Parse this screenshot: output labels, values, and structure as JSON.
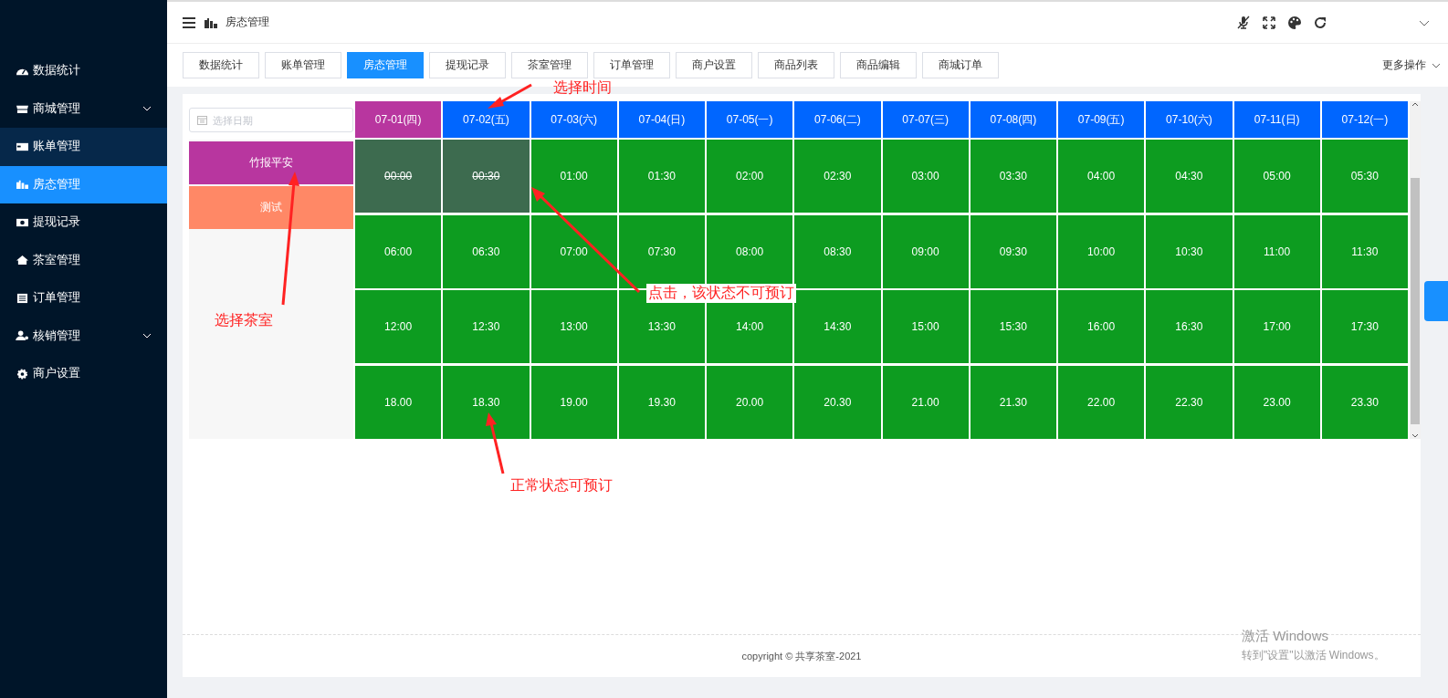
{
  "sidebar": {
    "items": [
      {
        "label": "数据统计",
        "expandable": false,
        "selected": false,
        "hovered": false
      },
      {
        "label": "商城管理",
        "expandable": true,
        "selected": false,
        "hovered": false
      },
      {
        "label": "账单管理",
        "expandable": false,
        "selected": false,
        "hovered": true
      },
      {
        "label": "房态管理",
        "expandable": false,
        "selected": true,
        "hovered": false
      },
      {
        "label": "提现记录",
        "expandable": false,
        "selected": false,
        "hovered": false
      },
      {
        "label": "茶室管理",
        "expandable": false,
        "selected": false,
        "hovered": false
      },
      {
        "label": "订单管理",
        "expandable": false,
        "selected": false,
        "hovered": false
      },
      {
        "label": "核销管理",
        "expandable": true,
        "selected": false,
        "hovered": false
      },
      {
        "label": "商户设置",
        "expandable": false,
        "selected": false,
        "hovered": false
      }
    ]
  },
  "header": {
    "breadcrumb": "房态管理"
  },
  "tabs": [
    {
      "label": "数据统计",
      "selected": false
    },
    {
      "label": "账单管理",
      "selected": false
    },
    {
      "label": "房态管理",
      "selected": true
    },
    {
      "label": "提现记录",
      "selected": false
    },
    {
      "label": "茶室管理",
      "selected": false
    },
    {
      "label": "订单管理",
      "selected": false
    },
    {
      "label": "商户设置",
      "selected": false
    },
    {
      "label": "商品列表",
      "selected": false
    },
    {
      "label": "商品编辑",
      "selected": false
    },
    {
      "label": "商城订单",
      "selected": false
    }
  ],
  "more_actions": "更多操作",
  "date_picker": {
    "placeholder": "选择日期"
  },
  "rooms": [
    {
      "name": "竹报平安",
      "selected": true
    },
    {
      "name": "测试",
      "selected": false
    }
  ],
  "dates": [
    {
      "label": "07-01(四)",
      "selected": true
    },
    {
      "label": "07-02(五)",
      "selected": false
    },
    {
      "label": "07-03(六)",
      "selected": false
    },
    {
      "label": "07-04(日)",
      "selected": false
    },
    {
      "label": "07-05(一)",
      "selected": false
    },
    {
      "label": "07-06(二)",
      "selected": false
    },
    {
      "label": "07-07(三)",
      "selected": false
    },
    {
      "label": "07-08(四)",
      "selected": false
    },
    {
      "label": "07-09(五)",
      "selected": false
    },
    {
      "label": "07-10(六)",
      "selected": false
    },
    {
      "label": "07-11(日)",
      "selected": false
    },
    {
      "label": "07-12(一)",
      "selected": false
    }
  ],
  "slots": [
    {
      "time": "00:00",
      "booked": true
    },
    {
      "time": "00:30",
      "booked": true
    },
    {
      "time": "01:00",
      "booked": false
    },
    {
      "time": "01:30",
      "booked": false
    },
    {
      "time": "02:00",
      "booked": false
    },
    {
      "time": "02:30",
      "booked": false
    },
    {
      "time": "03:00",
      "booked": false
    },
    {
      "time": "03:30",
      "booked": false
    },
    {
      "time": "04:00",
      "booked": false
    },
    {
      "time": "04:30",
      "booked": false
    },
    {
      "time": "05:00",
      "booked": false
    },
    {
      "time": "05:30",
      "booked": false
    },
    {
      "time": "06:00",
      "booked": false
    },
    {
      "time": "06:30",
      "booked": false
    },
    {
      "time": "07:00",
      "booked": false
    },
    {
      "time": "07:30",
      "booked": false
    },
    {
      "time": "08:00",
      "booked": false
    },
    {
      "time": "08:30",
      "booked": false
    },
    {
      "time": "09:00",
      "booked": false
    },
    {
      "time": "09:30",
      "booked": false
    },
    {
      "time": "10:00",
      "booked": false
    },
    {
      "time": "10:30",
      "booked": false
    },
    {
      "time": "11:00",
      "booked": false
    },
    {
      "time": "11:30",
      "booked": false
    },
    {
      "time": "12:00",
      "booked": false
    },
    {
      "time": "12:30",
      "booked": false
    },
    {
      "time": "13:00",
      "booked": false
    },
    {
      "time": "13:30",
      "booked": false
    },
    {
      "time": "14:00",
      "booked": false
    },
    {
      "time": "14:30",
      "booked": false
    },
    {
      "time": "15:00",
      "booked": false
    },
    {
      "time": "15:30",
      "booked": false
    },
    {
      "time": "16:00",
      "booked": false
    },
    {
      "time": "16:30",
      "booked": false
    },
    {
      "time": "17:00",
      "booked": false
    },
    {
      "time": "17:30",
      "booked": false
    },
    {
      "time": "18.00",
      "booked": false
    },
    {
      "time": "18.30",
      "booked": false
    },
    {
      "time": "19.00",
      "booked": false
    },
    {
      "time": "19.30",
      "booked": false
    },
    {
      "time": "20.00",
      "booked": false
    },
    {
      "time": "20.30",
      "booked": false
    },
    {
      "time": "21.00",
      "booked": false
    },
    {
      "time": "21.30",
      "booked": false
    },
    {
      "time": "22.00",
      "booked": false
    },
    {
      "time": "22.30",
      "booked": false
    },
    {
      "time": "23.00",
      "booked": false
    },
    {
      "time": "23.30",
      "booked": false
    }
  ],
  "footer": "copyright © 共享茶室-2021",
  "annotations": [
    {
      "text": "选择时间",
      "kind": "time"
    },
    {
      "text": "选择茶室",
      "kind": "room"
    },
    {
      "text": "点击，该状态不可预订",
      "kind": "booked"
    },
    {
      "text": "正常状态可预订",
      "kind": "available"
    }
  ],
  "os_notice": {
    "title": "激活 Windows",
    "text": "转到\"设置\"以激活 Windows。"
  }
}
